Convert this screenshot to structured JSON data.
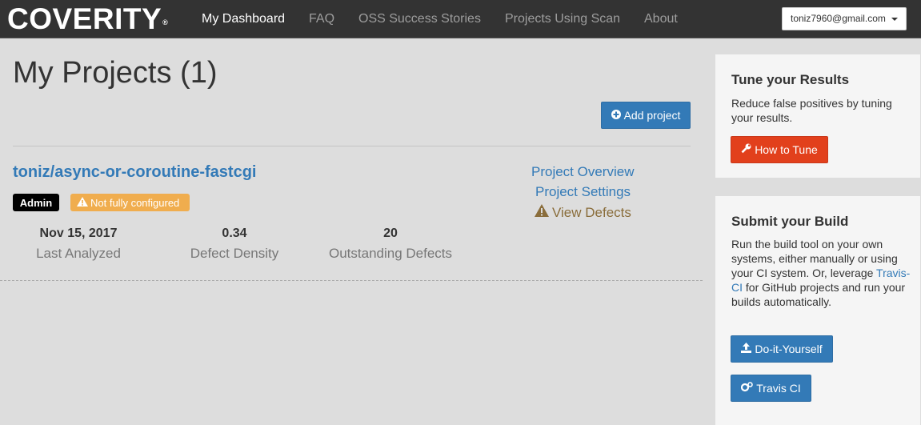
{
  "navbar": {
    "logo": "COVERITY",
    "logo_mark": "®",
    "links": [
      "My Dashboard",
      "FAQ",
      "OSS Success Stories",
      "Projects Using Scan",
      "About"
    ],
    "active": "My Dashboard",
    "user_email": "toniz7960@gmail.com"
  },
  "main": {
    "title": "My Projects (1)",
    "add_project_label": "Add project",
    "project": {
      "name": "toniz/async-or-coroutine-fastcgi",
      "badges": {
        "role": "Admin",
        "status": "Not fully configured"
      },
      "stats": [
        {
          "value": "Nov 15, 2017",
          "label": "Last Analyzed"
        },
        {
          "value": "0.34",
          "label": "Defect Density"
        },
        {
          "value": "20",
          "label": "Outstanding Defects"
        }
      ],
      "links": {
        "overview": "Project Overview",
        "settings": "Project Settings",
        "defects": "View Defects"
      }
    }
  },
  "sidebar": {
    "tune": {
      "title": "Tune your Results",
      "text": "Reduce false positives by tuning your results.",
      "button_label": "How to Tune"
    },
    "build": {
      "title": "Submit your Build",
      "text_before": "Run the build tool on your own systems, either manually or using your CI system. Or, leverage ",
      "link": "Travis-CI",
      "text_after": " for GitHub projects and run your builds automatically.",
      "diy_label": "Do-it-Yourself",
      "travis_label": "Travis CI"
    }
  },
  "colors": {
    "primary": "#337ab7",
    "danger": "#e2401c",
    "warning": "#f0ad4e",
    "navbar": "#333333"
  },
  "icons": [
    "plus-circle-icon",
    "warning-icon",
    "wrench-icon",
    "upload-icon",
    "gears-icon",
    "caret-down-icon"
  ]
}
